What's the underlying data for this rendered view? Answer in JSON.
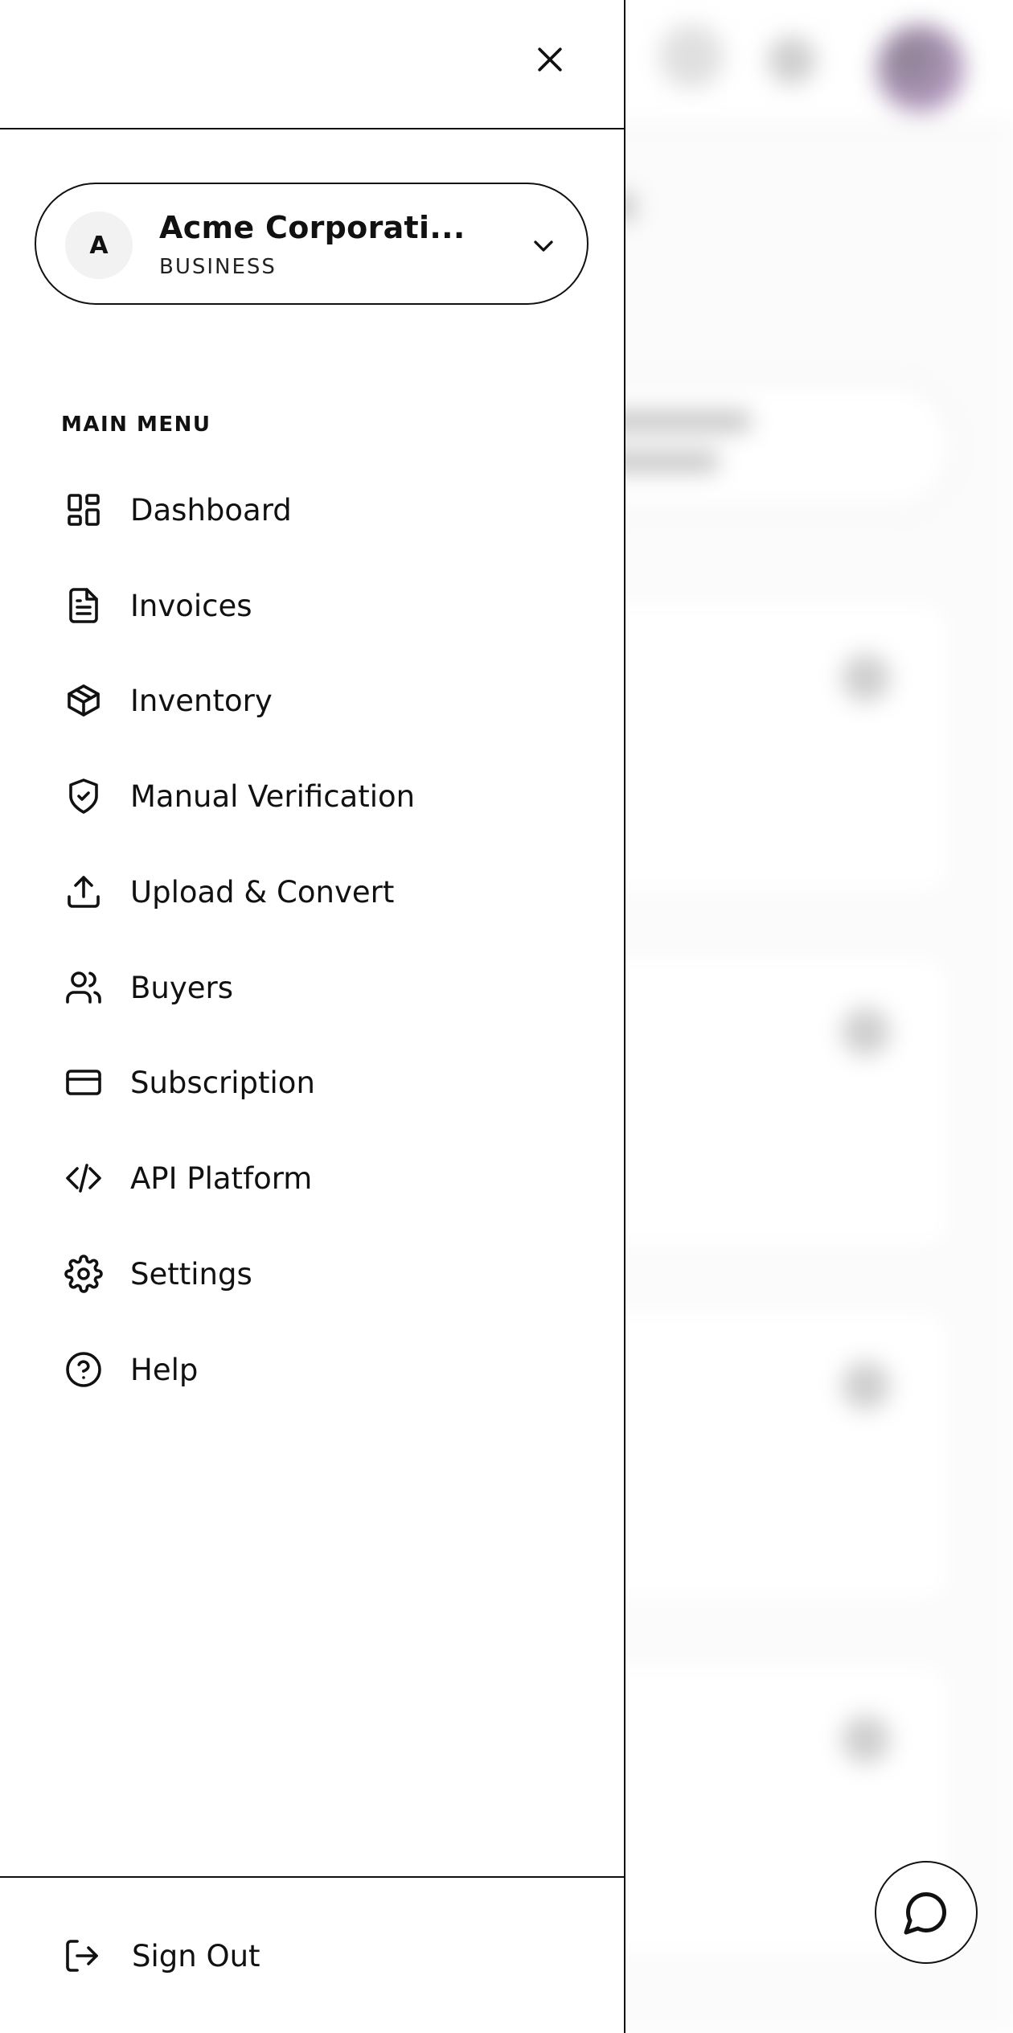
{
  "organization": {
    "initial": "A",
    "name": "Acme Corporati...",
    "type": "BUSINESS"
  },
  "menu": {
    "section_title": "MAIN MENU",
    "items": [
      {
        "label": "Dashboard",
        "icon": "dashboard-icon"
      },
      {
        "label": "Invoices",
        "icon": "file-text-icon"
      },
      {
        "label": "Inventory",
        "icon": "package-icon"
      },
      {
        "label": "Manual Verification",
        "icon": "shield-check-icon"
      },
      {
        "label": "Upload & Convert",
        "icon": "upload-icon"
      },
      {
        "label": "Buyers",
        "icon": "users-icon"
      },
      {
        "label": "Subscription",
        "icon": "credit-card-icon"
      },
      {
        "label": "API Platform",
        "icon": "code-icon"
      },
      {
        "label": "Settings",
        "icon": "gear-icon"
      },
      {
        "label": "Help",
        "icon": "help-circle-icon"
      }
    ]
  },
  "footer": {
    "sign_out_label": "Sign Out"
  }
}
